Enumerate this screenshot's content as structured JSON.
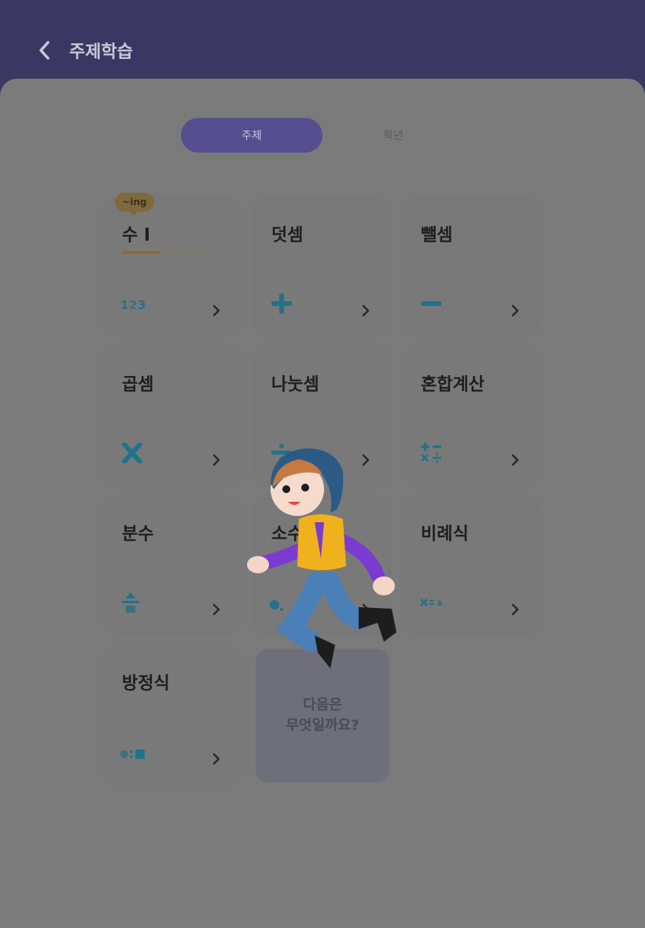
{
  "header": {
    "title": "주제학습"
  },
  "segments": {
    "topic": "주제",
    "grade": "학년"
  },
  "cards": [
    {
      "title": "수 I",
      "icon": "digits-123-icon",
      "progress": 0.4,
      "badge": "~ing"
    },
    {
      "title": "덧셈",
      "icon": "plus-icon"
    },
    {
      "title": "뺄셈",
      "icon": "minus-icon"
    },
    {
      "title": "곱셈",
      "icon": "times-icon"
    },
    {
      "title": "나눗셈",
      "icon": "divide-icon"
    },
    {
      "title": "혼합계산",
      "icon": "mixed-operations-icon"
    },
    {
      "title": "분수",
      "icon": "fraction-icon"
    },
    {
      "title": "소수",
      "icon": "decimal-icon"
    },
    {
      "title": "비례식",
      "icon": "proportion-icon"
    },
    {
      "title": "방정식",
      "icon": "equation-icon"
    }
  ],
  "next_card": {
    "line1": "다음은",
    "line2": "무엇일까요?"
  },
  "character": "jumping-boy-character",
  "colors": {
    "header": "#3a3862",
    "overlay_dim": "#7a7a7a",
    "accent_teal": "#20738a",
    "selected_segment": "#554f8f",
    "progress": "#8a6d2d"
  }
}
